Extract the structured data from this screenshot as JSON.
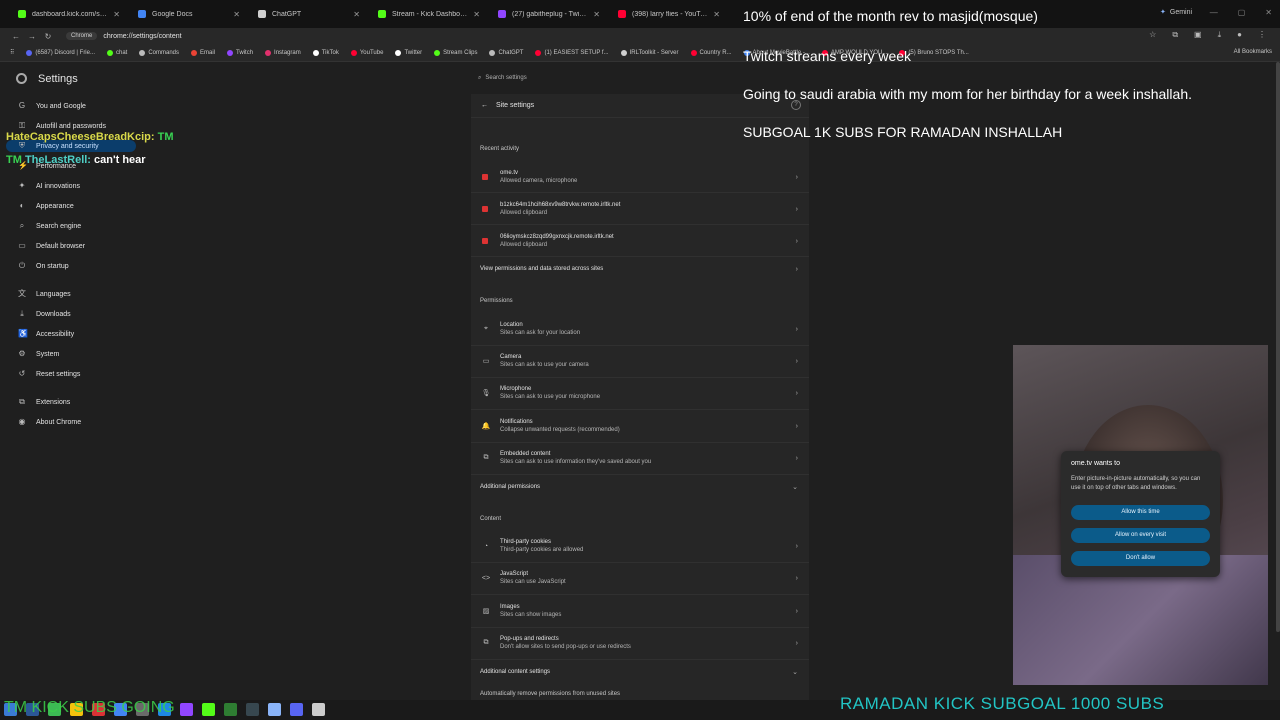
{
  "tabs": [
    {
      "title": "dashboard.kick.com/stream",
      "color": "#53fc18",
      "active": false
    },
    {
      "title": "Google Docs",
      "color": "#4285f4",
      "active": false
    },
    {
      "title": "ChatGPT",
      "color": "#d0d0d0",
      "active": false
    },
    {
      "title": "Stream - Kick Dashboard",
      "color": "#53fc18",
      "active": false
    },
    {
      "title": "(27) gabitheplug - Twitch",
      "color": "#9146ff",
      "active": false
    },
    {
      "title": "(398) larry flies - YouTube",
      "color": "#ff0033",
      "active": false
    }
  ],
  "gemini_label": "Gemini",
  "omnibox": {
    "chip": "Chrome",
    "url": "chrome://settings/content"
  },
  "bookmarks": [
    {
      "label": "(6587) Discord | Frie...",
      "color": "#5865f2"
    },
    {
      "label": "chat",
      "color": "#53fc18"
    },
    {
      "label": "Commands",
      "color": "#bbbbbb"
    },
    {
      "label": "Email",
      "color": "#ea4335"
    },
    {
      "label": "Twitch",
      "color": "#9146ff"
    },
    {
      "label": "Instagram",
      "color": "#e1306c"
    },
    {
      "label": "TikTok",
      "color": "#ffffff"
    },
    {
      "label": "YouTube",
      "color": "#ff0033"
    },
    {
      "label": "Twitter",
      "color": "#ffffff"
    },
    {
      "label": "Stream Clips",
      "color": "#53fc18"
    },
    {
      "label": "ChatGPT",
      "color": "#bbbbbb"
    },
    {
      "label": "(1) EASIEST SETUP f...",
      "color": "#ff0033"
    },
    {
      "label": "IRLToolkit - Server",
      "color": "#d0d0d0"
    },
    {
      "label": "Country R...",
      "color": "#ff0033"
    },
    {
      "label": "About MovieBattle -...",
      "color": "#4285f4"
    },
    {
      "label": "AMP WOULD YOU...",
      "color": "#ff0033"
    },
    {
      "label": "(5) Bruno STOPS Th...",
      "color": "#ff0033"
    }
  ],
  "all_bookmarks": "All Bookmarks",
  "settings": {
    "title": "Settings",
    "search_placeholder": "Search settings",
    "sidebar": [
      {
        "label": "You and Google",
        "icon": "G"
      },
      {
        "label": "Autofill and passwords",
        "icon": "⚿"
      },
      {
        "label": "Privacy and security",
        "icon": "⛨",
        "active": true
      },
      {
        "label": "Performance",
        "icon": "⚡"
      },
      {
        "label": "AI innovations",
        "icon": "✦"
      },
      {
        "label": "Appearance",
        "icon": "◐"
      },
      {
        "label": "Search engine",
        "icon": "⌕"
      },
      {
        "label": "Default browser",
        "icon": "▭"
      },
      {
        "label": "On startup",
        "icon": "⏻"
      },
      {
        "label": "Languages",
        "icon": "文"
      },
      {
        "label": "Downloads",
        "icon": "⤓"
      },
      {
        "label": "Accessibility",
        "icon": "♿"
      },
      {
        "label": "System",
        "icon": "⚙"
      },
      {
        "label": "Reset settings",
        "icon": "↺"
      },
      {
        "label": "Extensions",
        "icon": "⧉"
      },
      {
        "label": "About Chrome",
        "icon": "◉"
      }
    ]
  },
  "site_settings": {
    "header": "Site settings",
    "recent_activity_title": "Recent activity",
    "recent": [
      {
        "site": "ome.tv",
        "detail": "Allowed camera, microphone"
      },
      {
        "site": "b1zkc64m1hcih68xv9w8trvkw.remote.irltk.net",
        "detail": "Allowed clipboard"
      },
      {
        "site": "06lioymskcz8zqd99gxnxcjk.remote.irltk.net",
        "detail": "Allowed clipboard"
      }
    ],
    "view_permissions": "View permissions and data stored across sites",
    "permissions_title": "Permissions",
    "permissions": [
      {
        "name": "Location",
        "detail": "Sites can ask for your location",
        "icon": "⌖"
      },
      {
        "name": "Camera",
        "detail": "Sites can ask to use your camera",
        "icon": "▭"
      },
      {
        "name": "Microphone",
        "detail": "Sites can ask to use your microphone",
        "icon": "🎙"
      },
      {
        "name": "Notifications",
        "detail": "Collapse unwanted requests (recommended)",
        "icon": "🔔"
      },
      {
        "name": "Embedded content",
        "detail": "Sites can ask to use information they've saved about you",
        "icon": "⧉"
      }
    ],
    "additional_permissions": "Additional permissions",
    "content_title": "Content",
    "content": [
      {
        "name": "Third-party cookies",
        "detail": "Third-party cookies are allowed",
        "icon": "◔"
      },
      {
        "name": "JavaScript",
        "detail": "Sites can use JavaScript",
        "icon": "<>"
      },
      {
        "name": "Images",
        "detail": "Sites can show images",
        "icon": "▨"
      },
      {
        "name": "Pop-ups and redirects",
        "detail": "Don't allow sites to send pop-ups or use redirects",
        "icon": "⧉"
      }
    ],
    "additional_content": "Additional content settings",
    "auto_remove": "Automatically remove permissions from unused sites"
  },
  "overlay": {
    "line1": "10% of end of the month rev to masjid(mosque)",
    "line2": "Twitch streams every week",
    "line3": "Going to saudi arabia with my mom for her birthday for a week inshallah.",
    "line4": "SUBGOAL 1K SUBS FOR RAMADAN INSHALLAH"
  },
  "chat": {
    "msg1_user": "HateCapsCheeseBreadKcip:",
    "msg1_tag": "TM",
    "msg2_tag": "TM",
    "msg2_user": "TheLastRell:",
    "msg2_text": "can't hear"
  },
  "popup": {
    "title": "ome.tv wants to",
    "desc": "Enter picture-in-picture automatically, so you can use it on top of other tabs and windows.",
    "allow_once": "Allow this time",
    "allow_always": "Allow on every visit",
    "deny": "Don't allow"
  },
  "ticker": "RAMADAN KICK SUBGOAL 1000 SUBS",
  "kick_sub": "TM KICK SUBS GOING"
}
